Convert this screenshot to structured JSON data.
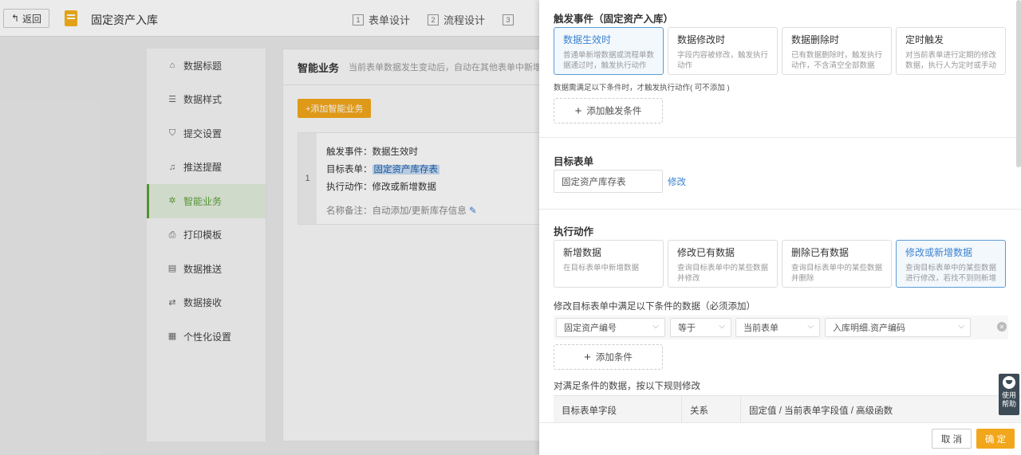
{
  "topbar": {
    "back_label": "返回",
    "title": "固定资产入库",
    "steps": [
      {
        "num": "1",
        "label": "表单设计"
      },
      {
        "num": "2",
        "label": "流程设计"
      },
      {
        "num": "3",
        "label": ""
      }
    ]
  },
  "sidebar": {
    "items": [
      {
        "label": "数据标题",
        "icon": "tag-icon"
      },
      {
        "label": "数据样式",
        "icon": "list-icon"
      },
      {
        "label": "提交设置",
        "icon": "shield-icon"
      },
      {
        "label": "推送提醒",
        "icon": "bell-icon"
      },
      {
        "label": "智能业务",
        "icon": "gear-icon",
        "active": true
      },
      {
        "label": "打印模板",
        "icon": "printer-icon"
      },
      {
        "label": "数据推送",
        "icon": "database-icon"
      },
      {
        "label": "数据接收",
        "icon": "receive-icon"
      },
      {
        "label": "个性化设置",
        "icon": "layout-icon"
      }
    ]
  },
  "main": {
    "title": "智能业务",
    "description": "当前表单数据发生变动后，自动在其他表单中新增、",
    "add_button": "+添加智能业务",
    "rule": {
      "index": "1",
      "trigger": "触发事件：数据生效时",
      "target_prefix": "目标表单：",
      "target": "固定资产库存表",
      "action": "执行动作：修改或新增数据",
      "remark": "名称备注：自动添加/更新库存信息"
    }
  },
  "drawer": {
    "trigger_title": "触发事件（固定资产入库）",
    "trigger_cards": [
      {
        "title": "数据生效时",
        "desc": "普通单新增数据或流程单数据通过时，触发执行动作",
        "selected": true
      },
      {
        "title": "数据修改时",
        "desc": "字段内容被修改，触发执行动作",
        "selected": false
      },
      {
        "title": "数据删除时",
        "desc": "已有数据删除时，触发执行动作，不含清空全部数据",
        "selected": false
      },
      {
        "title": "定时触发",
        "desc": "对当前表单进行定期的修改数据，执行人为定时或手动",
        "selected": false
      }
    ],
    "trigger_hint": "数据需满足以下条件时，才触发执行动作( 可不添加 )",
    "add_trigger_condition": "添加触发条件",
    "target_title": "目标表单",
    "target_value": "固定资产库存表",
    "modify_link": "修改",
    "action_title": "执行动作",
    "action_cards": [
      {
        "title": "新增数据",
        "desc": "在目标表单中新增数据",
        "selected": false
      },
      {
        "title": "修改已有数据",
        "desc": "查询目标表单中的某些数据并修改",
        "selected": false
      },
      {
        "title": "删除已有数据",
        "desc": "查询目标表单中的某些数据并删除",
        "selected": false
      },
      {
        "title": "修改或新增数据",
        "desc": "查询目标表单中的某些数据进行修改，若找不到则新增",
        "selected": true
      }
    ],
    "condition_hint": "修改目标表单中满足以下条件的数据（必须添加）",
    "condition": {
      "field": "固定资产编号",
      "operator": "等于",
      "source": "当前表单",
      "value": "入库明细.资产编码"
    },
    "add_condition": "添加条件",
    "rule_hint": "对满足条件的数据，按以下规则修改",
    "table_headers": [
      "目标表单字段",
      "关系",
      "固定值 / 当前表单字段值 / 高级函数"
    ],
    "cancel": "取 消",
    "ok": "确 定"
  },
  "help": {
    "line1": "使用",
    "line2": "帮助"
  }
}
